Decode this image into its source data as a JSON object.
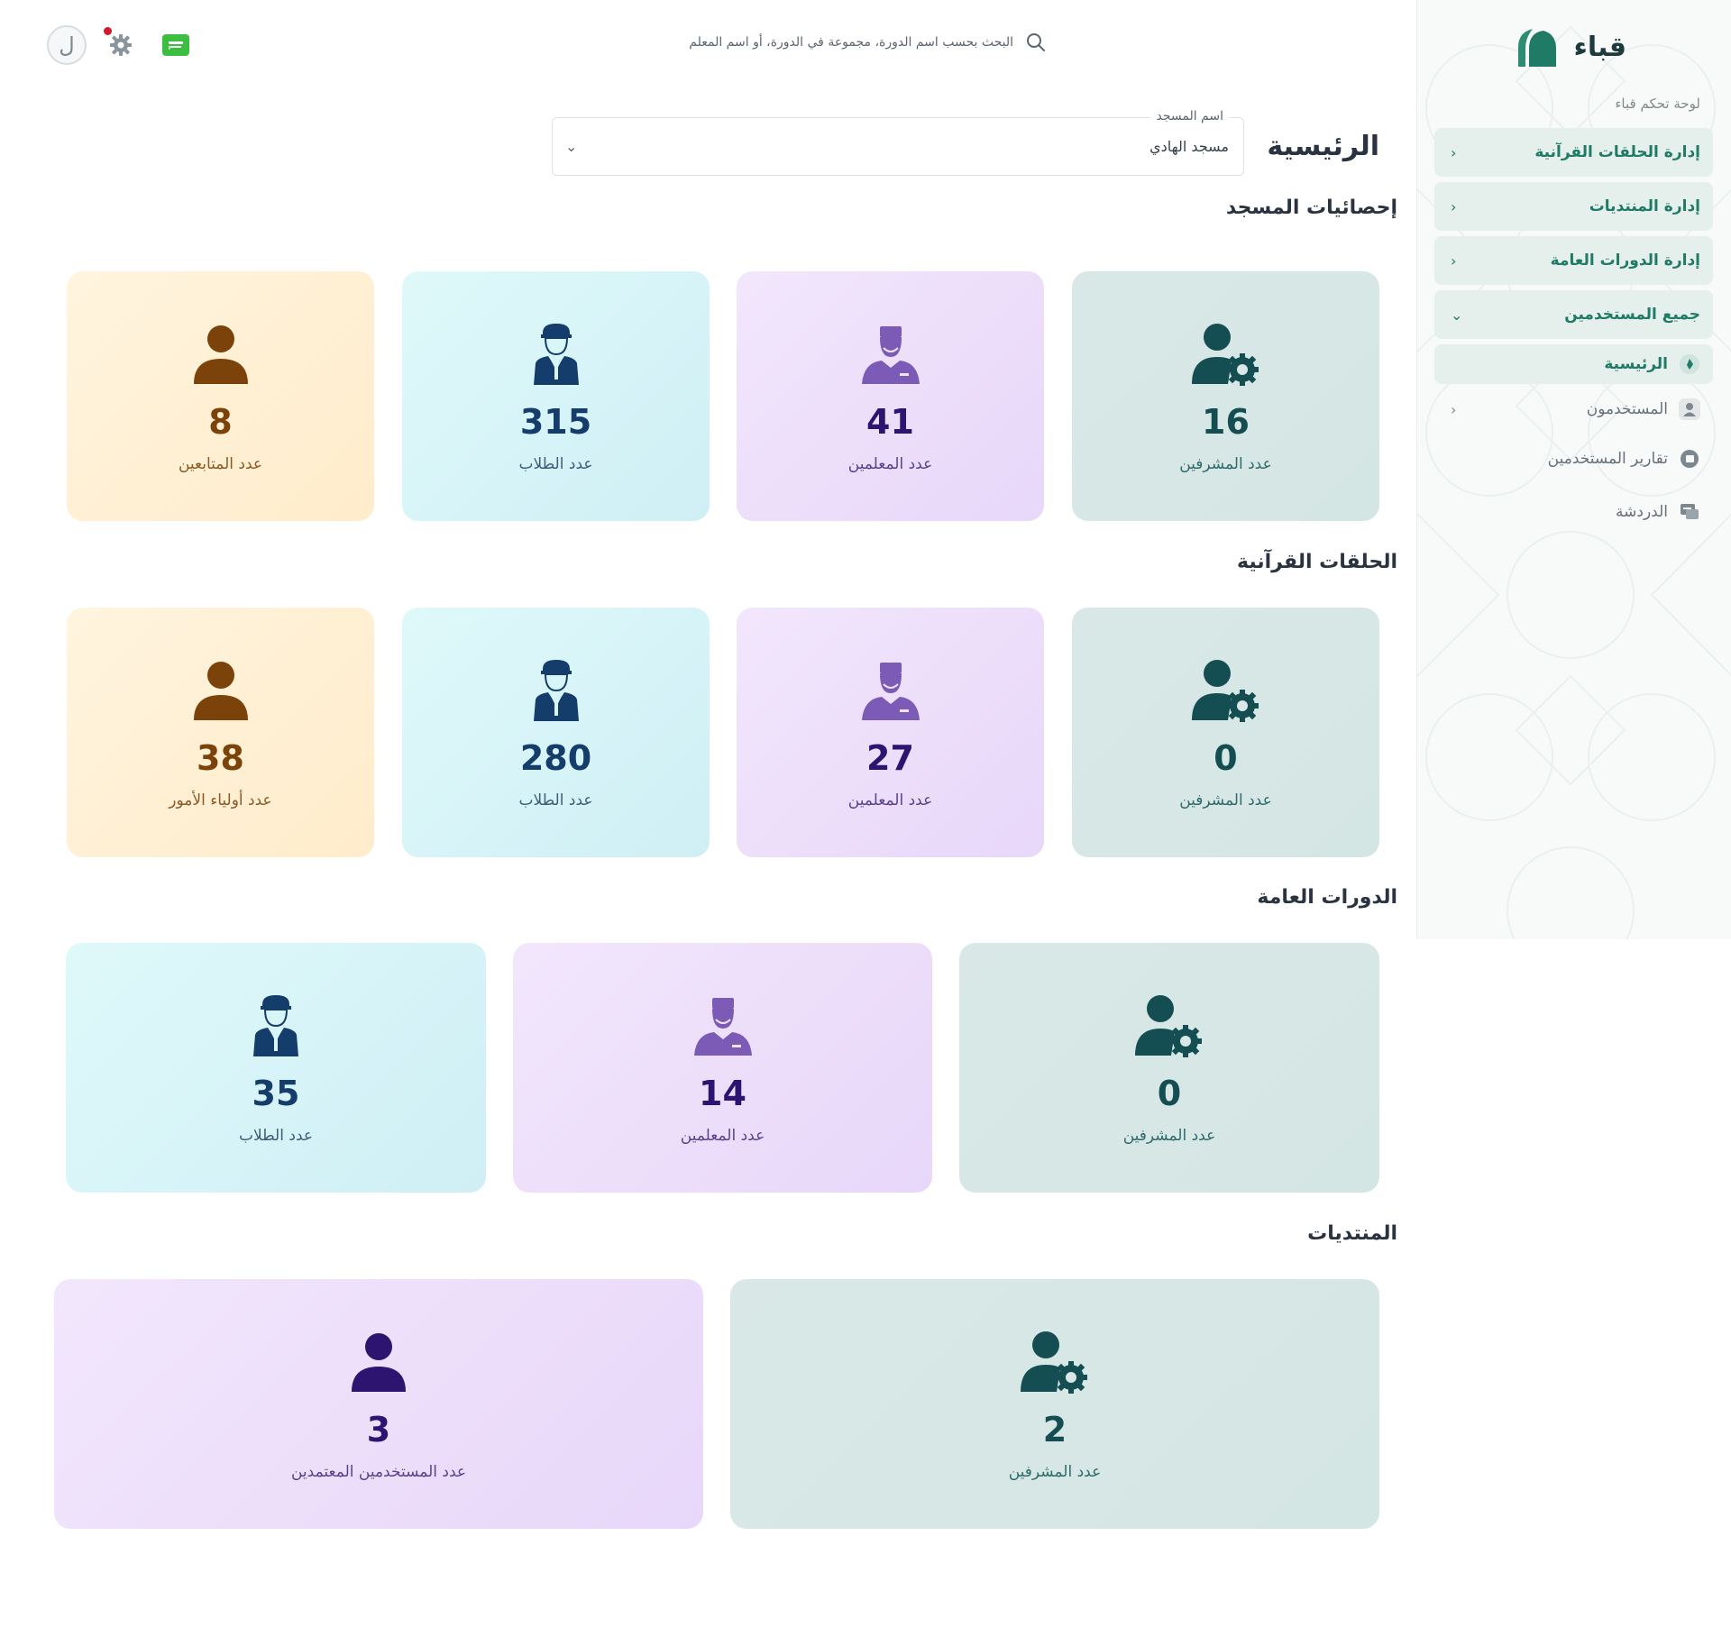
{
  "brand": {
    "name": "قباء",
    "caption": "لوحة تحكم قباء"
  },
  "sidebar": {
    "menu": [
      {
        "label": "إدارة الحلقات القرآنية",
        "chevron": "‹"
      },
      {
        "label": "إدارة المنتديات",
        "chevron": "‹"
      },
      {
        "label": "إدارة الدورات العامة",
        "chevron": "‹"
      },
      {
        "label": "جميع المستخدمين",
        "chevron": "⌄"
      }
    ],
    "subitems": [
      {
        "label": "الرئيسية",
        "icon": "home-icon"
      },
      {
        "label": "المستخدمون",
        "icon": "user-icon",
        "chevron": "‹"
      },
      {
        "label": "تقارير المستخدمين",
        "icon": "report-icon"
      },
      {
        "label": "الدردشة",
        "icon": "chat-icon"
      }
    ]
  },
  "header": {
    "search_placeholder": "البحث بحسب اسم الدورة، مجموعة في الدورة، أو اسم المعلم",
    "avatar_letter": "ل"
  },
  "page": {
    "title": "الرئيسية",
    "mosque_select": {
      "label": "اسم المسجد",
      "value": "مسجد الهادي"
    }
  },
  "sections": {
    "mosque": {
      "title": "إحصائيات المسجد",
      "cards": [
        {
          "value": "16",
          "label": "عدد المشرفين"
        },
        {
          "value": "41",
          "label": "عدد المعلمين"
        },
        {
          "value": "315",
          "label": "عدد الطلاب"
        },
        {
          "value": "8",
          "label": "عدد المتابعين"
        }
      ]
    },
    "quran": {
      "title": "الحلقات القرآنية",
      "cards": [
        {
          "value": "0",
          "label": "عدد المشرفين"
        },
        {
          "value": "27",
          "label": "عدد المعلمين"
        },
        {
          "value": "280",
          "label": "عدد الطلاب"
        },
        {
          "value": "38",
          "label": "عدد أولياء الأمور"
        }
      ]
    },
    "courses": {
      "title": "الدورات العامة",
      "cards": [
        {
          "value": "0",
          "label": "عدد المشرفين"
        },
        {
          "value": "14",
          "label": "عدد المعلمين"
        },
        {
          "value": "35",
          "label": "عدد الطلاب"
        }
      ]
    },
    "forums": {
      "title": "المنتديات",
      "cards": [
        {
          "value": "2",
          "label": "عدد المشرفين"
        },
        {
          "value": "3",
          "label": "عدد المستخدمين المعتمدين"
        }
      ]
    }
  },
  "colors": {
    "accent": "#1f7a66",
    "teal_card": "#d9e8e6",
    "lavender_card": "#efe2fb",
    "cyan_card": "#d8f5f8",
    "sand_card": "#fff0d4",
    "notification": "#d11a2a",
    "flag_button": "#3cbf41"
  }
}
